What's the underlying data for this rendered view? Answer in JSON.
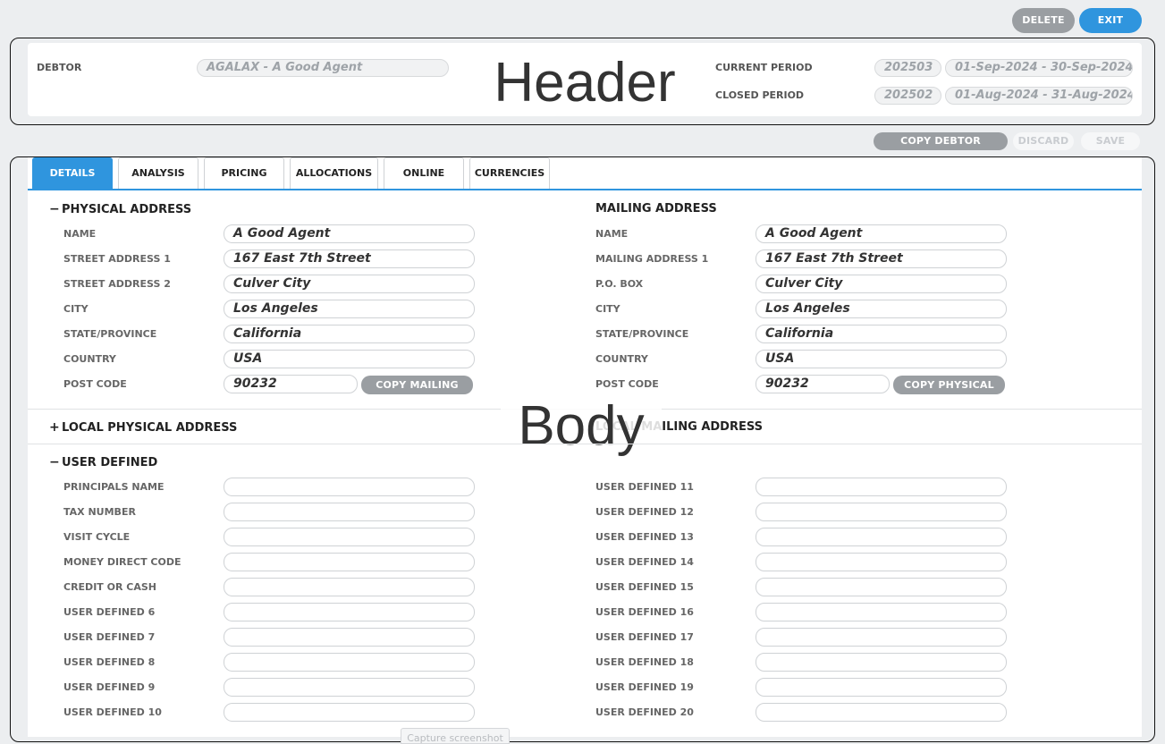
{
  "toolbar": {
    "delete_label": "DELETE",
    "exit_label": "EXIT"
  },
  "header": {
    "overlay": "Header",
    "debtor_label": "DEBTOR",
    "debtor_value": "AGALAX - A Good Agent",
    "current_period_label": "CURRENT PERIOD",
    "current_period_code": "202503",
    "current_period_range": "01-Sep-2024 - 30-Sep-2024",
    "closed_period_label": "CLOSED PERIOD",
    "closed_period_code": "202502",
    "closed_period_range": "01-Aug-2024 - 31-Aug-2024"
  },
  "actions": {
    "copy_debtor": "COPY DEBTOR",
    "discard": "DISCARD",
    "save": "SAVE"
  },
  "tabs": [
    "DETAILS",
    "ANALYSIS",
    "PRICING",
    "ALLOCATIONS",
    "ONLINE",
    "CURRENCIES"
  ],
  "body": {
    "overlay": "Body",
    "physical": {
      "title": "PHYSICAL ADDRESS",
      "sign": "−",
      "fields": [
        {
          "label": "NAME",
          "value": "A Good Agent"
        },
        {
          "label": "STREET ADDRESS 1",
          "value": "167 East 7th Street"
        },
        {
          "label": "STREET ADDRESS 2",
          "value": "Culver City"
        },
        {
          "label": "CITY",
          "value": "Los Angeles"
        },
        {
          "label": "STATE/PROVINCE",
          "value": "California"
        },
        {
          "label": "COUNTRY",
          "value": "USA"
        },
        {
          "label": "POST CODE",
          "value": "90232"
        }
      ],
      "copy_button": "COPY MAILING"
    },
    "mailing": {
      "title": "MAILING ADDRESS",
      "fields": [
        {
          "label": "NAME",
          "value": "A Good Agent"
        },
        {
          "label": "MAILING ADDRESS 1",
          "value": "167 East 7th Street"
        },
        {
          "label": "P.O. BOX",
          "value": "Culver City"
        },
        {
          "label": "CITY",
          "value": "Los Angeles"
        },
        {
          "label": "STATE/PROVINCE",
          "value": "California"
        },
        {
          "label": "COUNTRY",
          "value": "USA"
        },
        {
          "label": "POST CODE",
          "value": "90232"
        }
      ],
      "copy_button": "COPY PHYSICAL"
    },
    "local_physical": {
      "title": "LOCAL PHYSICAL ADDRESS",
      "sign": "+"
    },
    "local_mailing": {
      "title": "LOCAL MAILING ADDRESS"
    },
    "user_defined": {
      "title": "USER DEFINED",
      "sign": "−",
      "left": [
        "PRINCIPALS NAME",
        "TAX NUMBER",
        "VISIT CYCLE",
        "MONEY DIRECT CODE",
        "CREDIT OR CASH",
        "USER DEFINED 6",
        "USER DEFINED 7",
        "USER DEFINED 8",
        "USER DEFINED 9",
        "USER DEFINED 10"
      ],
      "right": [
        "USER DEFINED 11",
        "USER DEFINED 12",
        "USER DEFINED 13",
        "USER DEFINED 14",
        "USER DEFINED 15",
        "USER DEFINED 16",
        "USER DEFINED 17",
        "USER DEFINED 18",
        "USER DEFINED 19",
        "USER DEFINED 20"
      ]
    }
  },
  "capture_label": "Capture screenshot",
  "colors": {
    "accent": "#2f95de",
    "grey_button": "#9a9ea2"
  }
}
